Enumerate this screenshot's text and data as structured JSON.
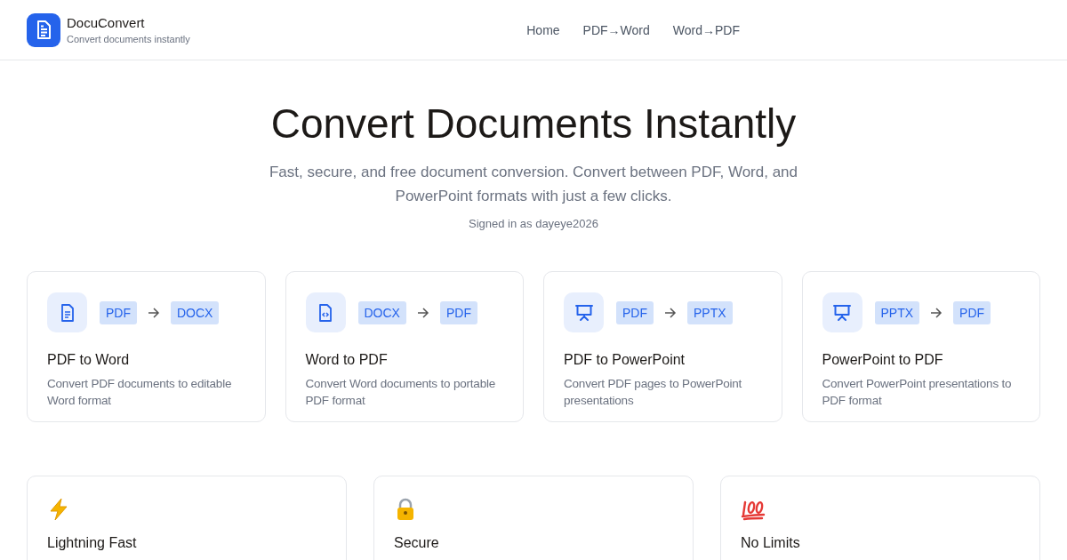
{
  "header": {
    "brand": "DocuConvert",
    "tagline": "Convert documents instantly",
    "nav": [
      {
        "label": "Home"
      },
      {
        "label": "PDF→Word"
      },
      {
        "label": "Word→PDF"
      }
    ]
  },
  "hero": {
    "title": "Convert Documents Instantly",
    "subtitle": "Fast, secure, and free document conversion. Convert between PDF, Word, and PowerPoint formats with just a few clicks.",
    "signed_in": "Signed in as dayeye2026"
  },
  "converters": [
    {
      "kind": "document",
      "from": "PDF",
      "to": "DOCX",
      "title": "PDF to Word",
      "description": "Convert PDF documents to editable Word format"
    },
    {
      "kind": "code",
      "from": "DOCX",
      "to": "PDF",
      "title": "Word to PDF",
      "description": "Convert Word documents to portable PDF format"
    },
    {
      "kind": "presentation",
      "from": "PDF",
      "to": "PPTX",
      "title": "PDF to PowerPoint",
      "description": "Convert PDF pages to PowerPoint presentations"
    },
    {
      "kind": "presentation",
      "from": "PPTX",
      "to": "PDF",
      "title": "PowerPoint to PDF",
      "description": "Convert PowerPoint presentations to PDF format"
    }
  ],
  "features": [
    {
      "kind": "lightning",
      "title": "Lightning Fast"
    },
    {
      "kind": "lock",
      "title": "Secure"
    },
    {
      "kind": "hundred",
      "title": "No Limits"
    }
  ]
}
